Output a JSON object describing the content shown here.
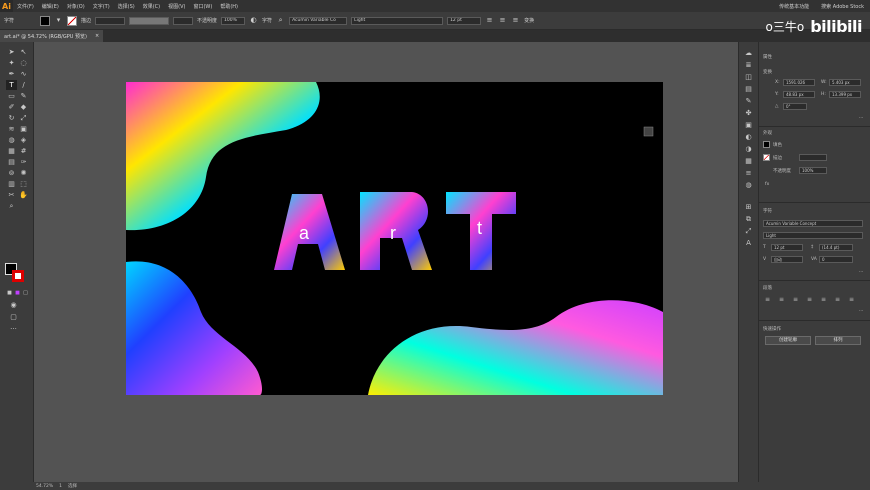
{
  "app": {
    "logo": "Ai",
    "accent": "#f79a1d"
  },
  "menu": [
    "文件(F)",
    "编辑(E)",
    "对象(O)",
    "文字(T)",
    "选择(S)",
    "效果(C)",
    "视图(V)",
    "窗口(W)",
    "帮助(H)"
  ],
  "menu_right": {
    "workspace": "传统基本功能",
    "search": "搜索 Adobe Stock"
  },
  "control": {
    "selection_label": "字符",
    "stroke_label": "描边",
    "opacity_label": "不透明度",
    "opacity_value": "100%",
    "char_label": "字符",
    "font_value": "Acumin Variable Co",
    "style_value": "Light",
    "size_value": "12 pt",
    "transform_label": "变换"
  },
  "doc_tab": {
    "title": "art.ai* @ 54.72% (RGB/GPU 预览)",
    "close": "×"
  },
  "canvas_text": {
    "a": "a",
    "r": "r",
    "t": "t"
  },
  "status": {
    "zoom": "54.72%",
    "page": "1",
    "mode": "选择"
  },
  "panel": {
    "properties_tab": "属性",
    "transform_label": "变换",
    "x_value": "1591.026",
    "y_value": "48.83 px",
    "w_value": "5.403 px",
    "h_value": "13.399 px",
    "angle_value": "0°",
    "appearance_label": "外观",
    "fill_label": "填色",
    "stroke_label": "描边",
    "opacity_label": "不透明度",
    "opacity_value": "100%",
    "char_section": "字符",
    "font_value": "Acumin Variable Concept",
    "style_value": "Light",
    "size_value": "12 pt",
    "leading_value": "(14.4 pt)",
    "tracking_value": "自动",
    "kerning_value": "0",
    "paragraph_label": "段落",
    "quick_actions_label": "快速操作",
    "create_outline_button": "创建轮廓",
    "arrange_button": "排列"
  },
  "watermark": {
    "logo_text": "bilibili",
    "left_text": "o三牛o"
  }
}
